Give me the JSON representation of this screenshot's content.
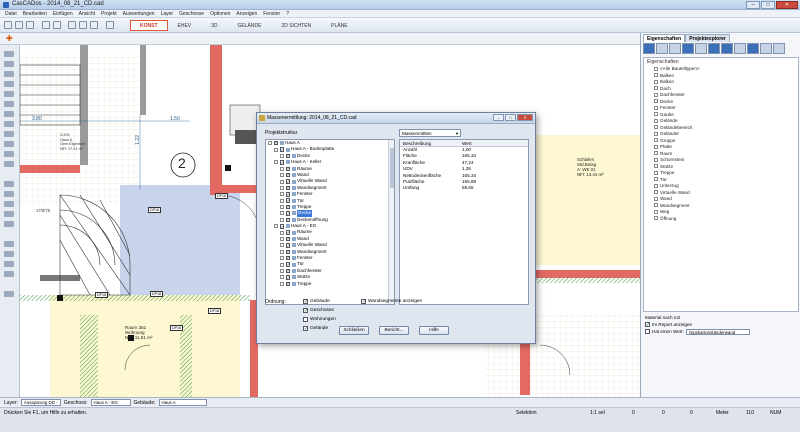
{
  "window": {
    "title": "CasCADos - 2014_08_21_CD.cad",
    "buttons": {
      "minimize": "–",
      "maximize": "□",
      "close": "✕"
    }
  },
  "menu": [
    "Datei",
    "Bearbeiten",
    "Einfügen",
    "Ansicht",
    "Projekt",
    "Auswertungen",
    "Layer",
    "Geschosse",
    "Optionen",
    "Anzeigen",
    "Fenster",
    "?"
  ],
  "tabs": [
    "KONST",
    "EHEV",
    "3D",
    "GELÄNDE",
    "2D SICHTEN",
    "PLÄNE"
  ],
  "active_tab": "KONST",
  "canvas": {
    "dim1": "3.80",
    "dim2": "1.50",
    "dim3": "1.22",
    "room_number": "2",
    "room_labels": [
      "G-EH",
      "Haus A",
      "Gem.Eigentum",
      "NFl: 17.01 m²"
    ],
    "stair_label": "17/0/75",
    "raum_label": "Raum 351",
    "raum_sub": [
      "Wohnung",
      "NFl: 11.51 m²"
    ],
    "schlafen_label": "Schlafen",
    "schlafen_sub": [
      "Std.Belag",
      "A: WE 01",
      "NFl: 14.44 m²"
    ],
    "tags": [
      "DP18",
      "DP18",
      "DP18",
      "DP18",
      "DP18",
      "DP18"
    ]
  },
  "dialog": {
    "title": "Massenermittlung: 2014_08_21_CD.cad",
    "structure_label": "Projektstruktur",
    "combo_value": "Massenmittlen",
    "tree": [
      {
        "depth": 0,
        "label": "Haus A",
        "checked": true
      },
      {
        "depth": 1,
        "label": "Haus A - Bodenplatte",
        "checked": true
      },
      {
        "depth": 2,
        "label": "Decke",
        "checked": true
      },
      {
        "depth": 1,
        "label": "Haus A - Keller",
        "checked": true
      },
      {
        "depth": 2,
        "label": "Räume",
        "checked": true
      },
      {
        "depth": 2,
        "label": "Wand",
        "checked": true
      },
      {
        "depth": 2,
        "label": "Virtuelle Wand",
        "checked": true
      },
      {
        "depth": 2,
        "label": "Wandsegment",
        "checked": true
      },
      {
        "depth": 2,
        "label": "Fenster",
        "checked": true
      },
      {
        "depth": 2,
        "label": "Tür",
        "checked": true
      },
      {
        "depth": 2,
        "label": "Treppe",
        "checked": true
      },
      {
        "depth": 2,
        "label": "Decke",
        "checked": true,
        "highlight": true
      },
      {
        "depth": 2,
        "label": "Deckenöffnung",
        "checked": true
      },
      {
        "depth": 1,
        "label": "Haus A - EG",
        "checked": true
      },
      {
        "depth": 2,
        "label": "Räume",
        "checked": true
      },
      {
        "depth": 2,
        "label": "Wand",
        "checked": true
      },
      {
        "depth": 2,
        "label": "Virtuelle Wand",
        "checked": true
      },
      {
        "depth": 2,
        "label": "Wandsegment",
        "checked": true
      },
      {
        "depth": 2,
        "label": "Fenster",
        "checked": true
      },
      {
        "depth": 2,
        "label": "Tür",
        "checked": true
      },
      {
        "depth": 2,
        "label": "Dachfenster",
        "checked": true
      },
      {
        "depth": 2,
        "label": "Stütze",
        "checked": true
      },
      {
        "depth": 2,
        "label": "Treppe",
        "checked": true
      }
    ],
    "table_headers": [
      "Beschreibung",
      "Wert"
    ],
    "table_rows": [
      [
        "Anzahl",
        "1,00"
      ],
      [
        "Fläche",
        "165,34"
      ],
      [
        "Kranfläche",
        "47,24"
      ],
      [
        "UDV",
        "1,35"
      ],
      [
        "Nettodeckenfläche",
        "165,34"
      ],
      [
        "Putzfläche",
        "155,88"
      ],
      [
        "Umfang",
        "59,55"
      ]
    ],
    "ordnung_label": "Ordnung:",
    "options": [
      {
        "label": "Gebäude",
        "checked": true
      },
      {
        "label": "Geschosse",
        "checked": true
      },
      {
        "label": "Wohnungen",
        "checked": false
      },
      {
        "label": "Gelände",
        "checked": true
      }
    ],
    "wandsegmente_label": "Wandsegmente anzeigen",
    "wandsegmente_checked": true,
    "buttons": [
      "Schließen",
      "Bericht...",
      "Hilfe"
    ]
  },
  "right_panel": {
    "tabs": [
      "Eigenschaften",
      "Projektexplorer"
    ],
    "header": "Eigenschaften",
    "items": [
      "<Alle Bauteiltypen>",
      "Balken",
      "Balkon",
      "Dach",
      "Dachfenster",
      "Decke",
      "Fenster",
      "Gaube",
      "Gelände",
      "Geländebereich",
      "Geländer",
      "Gruppe",
      "Platte",
      "Raum",
      "Schornstein",
      "Stütze",
      "Treppe",
      "Tür",
      "Unterzug",
      "Virtuelle Wand",
      "Wand",
      "Wandsegment",
      "Weg",
      "Öffnung"
    ],
    "material_label": "Material nach m2",
    "report_label": "Im Report anzeigen",
    "wert_label": "Hat einen Wert:",
    "wert_value": "Gipskartonständerwand"
  },
  "layerbar": {
    "layer_label": "Layer:",
    "layer_value": "Aussparung DD - V",
    "geschoss_label": "Geschoss:",
    "geschoss_value": "Haus A - EG",
    "gebaeude_label": "Gebäude:",
    "gebaeude_value": "Haus A"
  },
  "status": {
    "hint": "Drücken Sie F1, um Hilfe zu erhalten.",
    "mode": "Selektion",
    "scale": "1:1 sel",
    "x": "0",
    "y": "0",
    "z": "0",
    "unit": "Meter",
    "zoom": "110",
    "num": "NUM"
  }
}
